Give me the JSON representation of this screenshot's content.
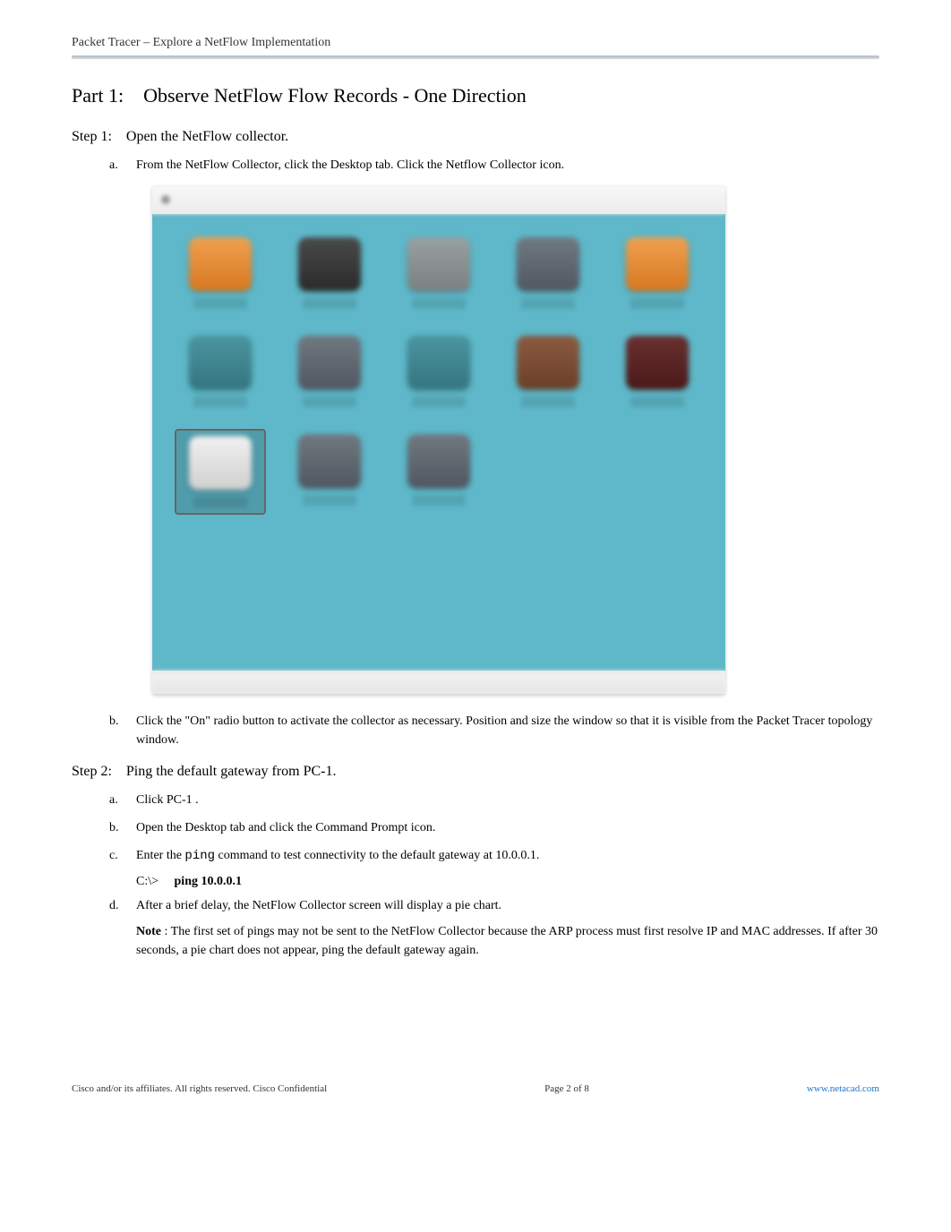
{
  "header": {
    "doc_title": "Packet Tracer – Explore a NetFlow Implementation"
  },
  "part": {
    "label": "Part 1:",
    "title": "Observe NetFlow Flow Records - One Direction"
  },
  "step1": {
    "label": "Step 1:",
    "title": "Open the NetFlow collector.",
    "a": {
      "marker": "a.",
      "text": "From the NetFlow Collector, click the Desktop tab. Click the Netflow Collector icon."
    },
    "b": {
      "marker": "b.",
      "text": "Click the \"On\" radio button to activate the collector as necessary. Position and size the window so that it is visible from the Packet Tracer topology window."
    }
  },
  "step2": {
    "label": "Step 2:",
    "title": "Ping the default gateway from PC-1.",
    "a": {
      "marker": "a.",
      "text": "Click PC-1 ."
    },
    "b": {
      "marker": "b.",
      "text": "Open the Desktop tab and click the Command Prompt icon."
    },
    "c": {
      "marker": "c.",
      "prefix": "Enter the  ",
      "cmd_name": "ping",
      "suffix": "  command to test connectivity to the default gateway at 10.0.0.1.",
      "prompt": "C:\\>",
      "cmd": "ping 10.0.0.1"
    },
    "d": {
      "marker": "d.",
      "text": "After a brief delay, the NetFlow Collector screen will display a pie chart.",
      "note_label": "Note",
      "note_text": " : The first set of pings may not be sent to the NetFlow Collector because the ARP process must first resolve IP and MAC addresses. If after 30 seconds, a pie chart does not appear, ping the default gateway again."
    }
  },
  "footer": {
    "left": "  Cisco and/or its affiliates. All rights reserved. Cisco Confidential",
    "center": "Page  2  of 8",
    "right": "www.netacad.com"
  }
}
